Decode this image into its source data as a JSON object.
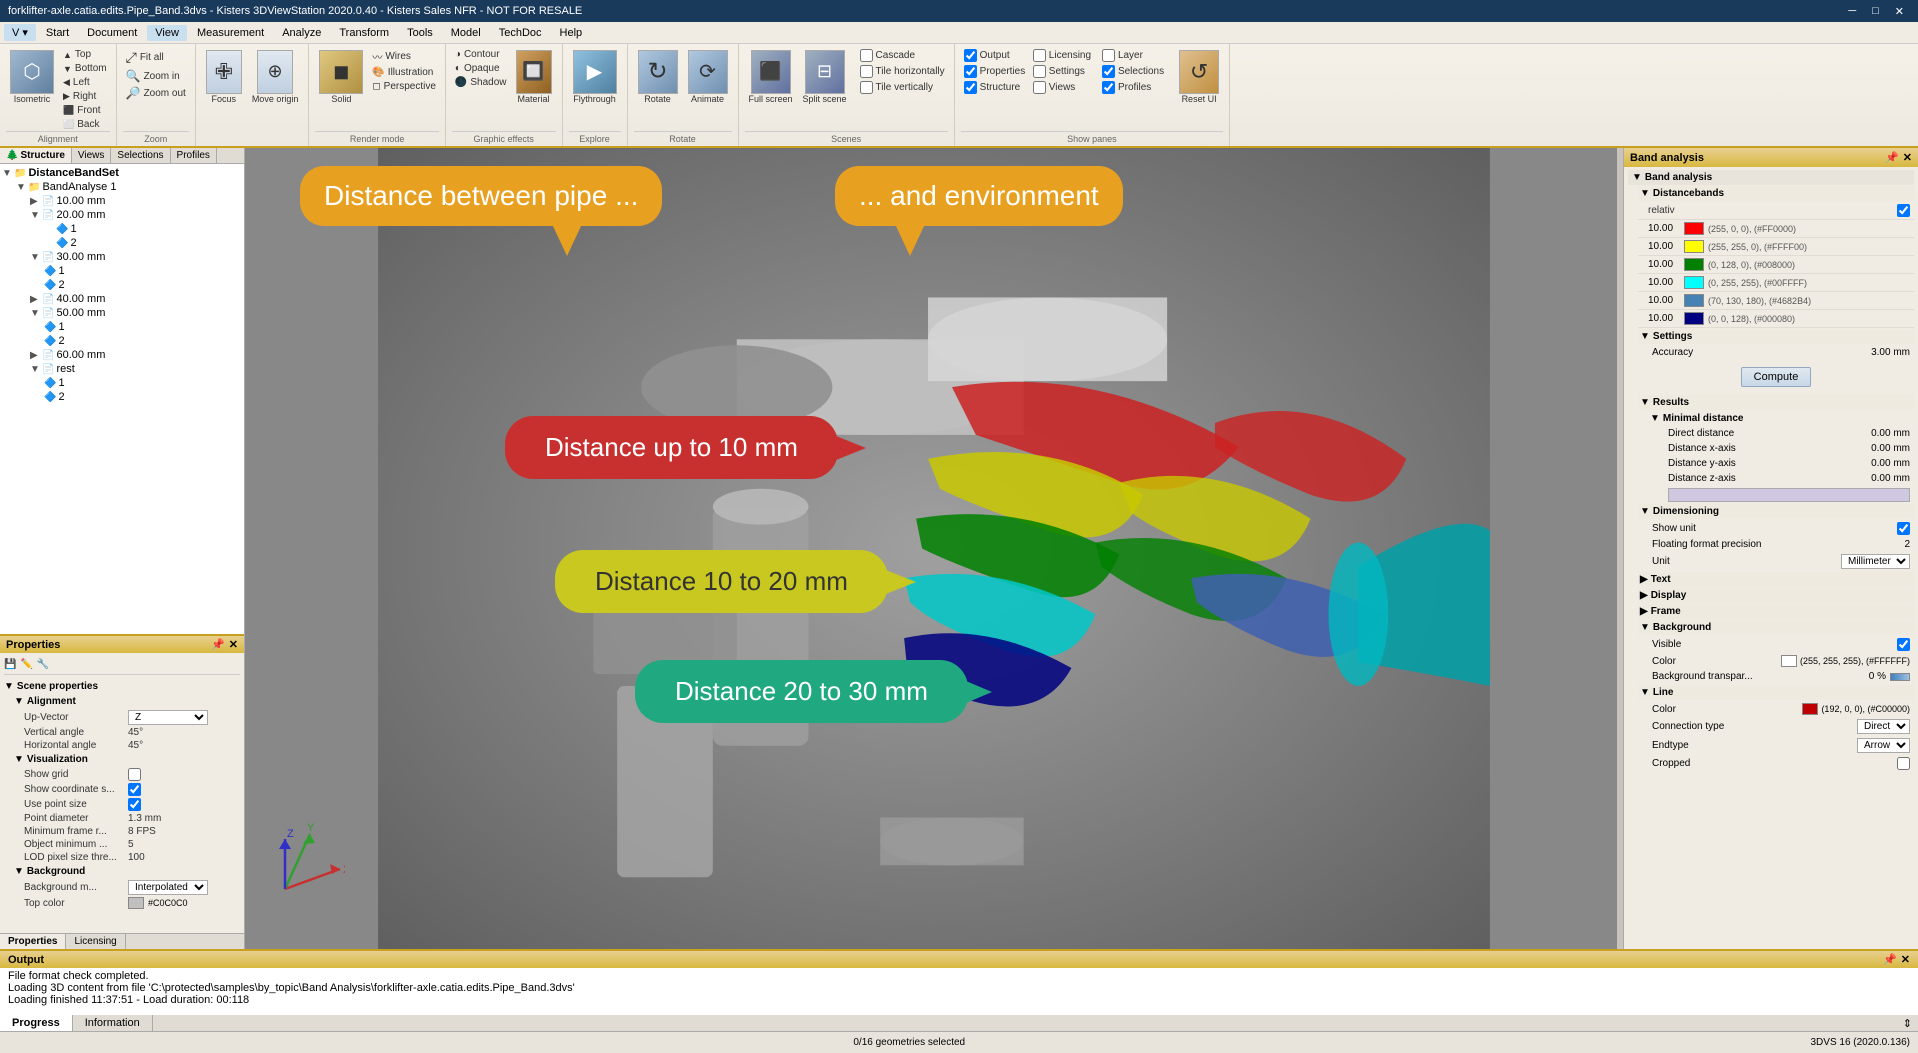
{
  "titlebar": {
    "title": "forklifter-axle.catia.edits.Pipe_Band.3dvs - Kisters 3DViewStation 2020.0.40 - Kisters Sales NFR - NOT FOR RESALE",
    "minimize": "─",
    "maximize": "□",
    "close": "✕"
  },
  "menubar": {
    "items": [
      "V ▾",
      "Start",
      "Document",
      "View",
      "Measurement",
      "Analyze",
      "Transform",
      "Tools",
      "Model",
      "TechDoc",
      "Help"
    ]
  },
  "ribbon": {
    "groups": [
      {
        "label": "Alignment",
        "buttons_large": [
          {
            "icon": "⬡",
            "label": "Isometric"
          }
        ],
        "buttons_small": [
          [
            {
              "icon": "⬆",
              "label": "Top"
            },
            {
              "icon": "⬇",
              "label": "Bottom"
            },
            {
              "icon": "⬅",
              "label": "Left"
            }
          ],
          [
            {
              "icon": "➡",
              "label": "Right"
            },
            {
              "icon": "⬛",
              "label": "Front"
            },
            {
              "icon": "⬜",
              "label": "Back"
            }
          ]
        ]
      },
      {
        "label": "Zoom",
        "buttons_large": [],
        "buttons_small": [
          {
            "icon": "⤢",
            "label": "Fit all"
          },
          {
            "icon": "🔍+",
            "label": "Zoom in"
          },
          {
            "icon": "🔍-",
            "label": "Zoom out"
          }
        ]
      },
      {
        "label": "",
        "buttons_large": [
          {
            "icon": "✙",
            "label": "Focus"
          },
          {
            "icon": "⊕",
            "label": "Move origin"
          }
        ]
      },
      {
        "label": "Render mode",
        "buttons_large": [
          {
            "icon": "◼",
            "label": "Solid"
          }
        ],
        "buttons_small": [
          {
            "icon": "〰",
            "label": "Wires"
          },
          {
            "icon": "🎨",
            "label": "Illustration"
          },
          {
            "icon": "◻",
            "label": "Perspective"
          }
        ]
      },
      {
        "label": "Graphic effects",
        "buttons_large": [
          {
            "icon": "🔲",
            "label": "Material"
          }
        ],
        "buttons_small": [
          {
            "icon": "◑",
            "label": "Contour"
          },
          {
            "icon": "◐",
            "label": "Opaque"
          },
          {
            "icon": "🌑",
            "label": "Shadow"
          }
        ]
      },
      {
        "label": "Explore",
        "buttons_large": [
          {
            "icon": "▶",
            "label": "Flythrough"
          }
        ]
      },
      {
        "label": "Rotate",
        "buttons_large": [
          {
            "icon": "↻",
            "label": "Rotate"
          },
          {
            "icon": "⟳",
            "label": "Animate"
          }
        ]
      },
      {
        "label": "Scenes",
        "buttons_large": [
          {
            "icon": "⬛",
            "label": "Full screen"
          },
          {
            "icon": "⊟",
            "label": "Split scene"
          }
        ],
        "checkboxes": [
          "Cascade",
          "Tile horizontally",
          "Tile vertically"
        ]
      },
      {
        "label": "Show panes",
        "checkboxes": [
          {
            "label": "Output",
            "checked": true
          },
          {
            "label": "Licensing",
            "checked": false
          },
          {
            "label": "Layer",
            "checked": false
          },
          {
            "label": "Properties",
            "checked": true
          },
          {
            "label": "Settings",
            "checked": false
          },
          {
            "label": "Selections",
            "checked": true
          },
          {
            "label": "Structure",
            "checked": true
          },
          {
            "label": "Views",
            "checked": false
          },
          {
            "label": "Profiles",
            "checked": true
          }
        ],
        "buttons_large": [
          {
            "icon": "↺",
            "label": "Reset UI"
          }
        ]
      }
    ]
  },
  "left_panel": {
    "str_label": "Str",
    "tabs": [
      {
        "label": "Structure",
        "active": true
      },
      {
        "label": "Views"
      },
      {
        "label": "Selections"
      },
      {
        "label": "Profiles"
      }
    ],
    "tree": [
      {
        "indent": 0,
        "expand": "▼",
        "icon": "📁",
        "label": "DistanceBandSet"
      },
      {
        "indent": 1,
        "expand": "▼",
        "icon": "📁",
        "label": "BandAnalyse 1"
      },
      {
        "indent": 2,
        "expand": "▼",
        "icon": "📄",
        "label": "10.00 mm"
      },
      {
        "indent": 2,
        "expand": "▼",
        "icon": "📄",
        "label": "20.00 mm"
      },
      {
        "indent": 3,
        "expand": "",
        "icon": "🔷",
        "label": "1"
      },
      {
        "indent": 3,
        "expand": "",
        "icon": "🔷",
        "label": "2"
      },
      {
        "indent": 2,
        "expand": "▼",
        "icon": "📄",
        "label": "30.00 mm"
      },
      {
        "indent": 3,
        "expand": "",
        "icon": "🔷",
        "label": "1"
      },
      {
        "indent": 3,
        "expand": "",
        "icon": "🔷",
        "label": "2"
      },
      {
        "indent": 2,
        "expand": "▼",
        "icon": "📄",
        "label": "40.00 mm"
      },
      {
        "indent": 2,
        "expand": "▼",
        "icon": "📄",
        "label": "50.00 mm"
      },
      {
        "indent": 3,
        "expand": "",
        "icon": "🔷",
        "label": "1"
      },
      {
        "indent": 3,
        "expand": "",
        "icon": "🔷",
        "label": "2"
      },
      {
        "indent": 2,
        "expand": "▼",
        "icon": "📄",
        "label": "60.00 mm"
      },
      {
        "indent": 2,
        "expand": "▼",
        "icon": "📄",
        "label": "rest"
      },
      {
        "indent": 3,
        "expand": "",
        "icon": "🔷",
        "label": "1"
      },
      {
        "indent": 3,
        "expand": "",
        "icon": "🔷",
        "label": "2"
      }
    ]
  },
  "properties": {
    "title": "Properties",
    "sections": [
      {
        "label": "Scene properties",
        "subsections": [
          {
            "label": "Alignment",
            "rows": [
              {
                "label": "Up-Vector",
                "value": "Z"
              },
              {
                "label": "Vertical angle",
                "value": "45°"
              },
              {
                "label": "Horizontal angle",
                "value": "45°"
              }
            ]
          },
          {
            "label": "Visualization",
            "rows": [
              {
                "label": "Show grid",
                "type": "checkbox",
                "checked": false
              },
              {
                "label": "Show coordinate s...",
                "type": "checkbox",
                "checked": true
              },
              {
                "label": "Use point size",
                "type": "checkbox",
                "checked": true
              },
              {
                "label": "Point diameter",
                "value": "1.3 mm"
              },
              {
                "label": "Minimum frame r...",
                "value": "8 FPS"
              },
              {
                "label": "Object minimum ...",
                "value": "5"
              },
              {
                "label": "LOD pixel size thre...",
                "value": "100"
              }
            ]
          },
          {
            "label": "Background",
            "rows": [
              {
                "label": "Background m...",
                "value": "Interpolated"
              },
              {
                "label": "Top color",
                "value": "#C0C0C0",
                "type": "color"
              }
            ]
          }
        ]
      }
    ]
  },
  "viewport": {
    "bubbles": [
      {
        "id": "pipe",
        "text": "Distance between pipe ...",
        "color": "#e8a020",
        "text_color": "white"
      },
      {
        "id": "env",
        "text": "... and environment",
        "color": "#e8a020",
        "text_color": "white"
      },
      {
        "id": "10mm",
        "text": "Distance up to 10 mm",
        "color": "#c83030",
        "text_color": "white"
      },
      {
        "id": "20mm",
        "text": "Distance 10 to 20 mm",
        "color": "#c8c820",
        "text_color": "#333"
      },
      {
        "id": "30mm",
        "text": "Distance 20 to 30 mm",
        "color": "#20a880",
        "text_color": "white"
      }
    ]
  },
  "right_panel": {
    "title": "Band analysis",
    "sections": [
      {
        "label": "Band analysis",
        "subsections": [
          {
            "label": "Distancebands",
            "rows": [
              {
                "type": "checkbox_row",
                "label": "relativ",
                "checked": true
              },
              {
                "type": "color_row",
                "value": "10.00",
                "color": "#FF0000",
                "color_text": "(255, 0, 0), (#FF0000)"
              },
              {
                "type": "color_row",
                "value": "10.00",
                "color": "#FFFF00",
                "color_text": "(255, 255, 0), (#FFFF00)"
              },
              {
                "type": "color_row",
                "value": "10.00",
                "color": "#008000",
                "color_text": "(0, 128, 0), (#008000)"
              },
              {
                "type": "color_row",
                "value": "10.00",
                "color": "#00FFFF",
                "color_text": "(0, 255, 255), (#00FFFF)"
              },
              {
                "type": "color_row",
                "value": "10.00",
                "color": "#4682B4",
                "color_text": "(70, 130, 180), (#4682B4)"
              },
              {
                "type": "color_row",
                "value": "10.00",
                "color": "#000080",
                "color_text": "(0, 0, 128), (#000080)"
              }
            ]
          },
          {
            "label": "Settings",
            "rows": [
              {
                "label": "Accuracy",
                "value": "3.00 mm"
              }
            ],
            "button": "Compute"
          },
          {
            "label": "Results",
            "subsub": [
              {
                "label": "Minimal distance",
                "rows": [
                  {
                    "label": "Direct distance",
                    "value": "0.00 mm"
                  },
                  {
                    "label": "Distance x-axis",
                    "value": "0.00 mm"
                  },
                  {
                    "label": "Distance y-axis",
                    "value": "0.00 mm"
                  },
                  {
                    "label": "Distance z-axis",
                    "value": "0.00 mm"
                  }
                ]
              }
            ]
          },
          {
            "label": "Dimensioning",
            "rows": [
              {
                "label": "Show unit",
                "type": "checkbox",
                "checked": true
              },
              {
                "label": "Floating format precision",
                "value": "2"
              },
              {
                "label": "Unit",
                "value": "Millimeter"
              }
            ]
          },
          {
            "label": "Text",
            "rows": []
          },
          {
            "label": "Display",
            "rows": []
          },
          {
            "label": "Frame",
            "rows": []
          },
          {
            "label": "Background",
            "rows": [
              {
                "label": "Visible",
                "type": "checkbox",
                "checked": true
              },
              {
                "label": "Color",
                "value": "(255, 255, 255), (#FFFFFF)",
                "type": "color_white"
              },
              {
                "label": "Background transpar...",
                "value": "0 %"
              }
            ]
          },
          {
            "label": "Line",
            "rows": [
              {
                "label": "Color",
                "value": "(192, 0, 0), (#C00000)",
                "type": "color_red"
              },
              {
                "label": "Connection type",
                "value": "Direct"
              },
              {
                "label": "Endtype",
                "value": "Arrow"
              },
              {
                "label": "Cropped",
                "type": "checkbox",
                "checked": false
              }
            ]
          }
        ]
      }
    ]
  },
  "output": {
    "title": "Output",
    "lines": [
      "File format check completed.",
      "Loading 3D content from file 'C:\\protected\\samples\\by_topic\\Band Analysis\\forklifter-axle.catia.edits.Pipe_Band.3dvs'",
      "Loading finished 11:37:51 - Load duration: 00:118"
    ],
    "tabs": [
      "Progress",
      "Information"
    ],
    "active_tab": "Progress"
  },
  "statusbar": {
    "left": "",
    "middle": "0/16 geometries selected",
    "right": "3DVS 16 (2020.0.136)"
  }
}
